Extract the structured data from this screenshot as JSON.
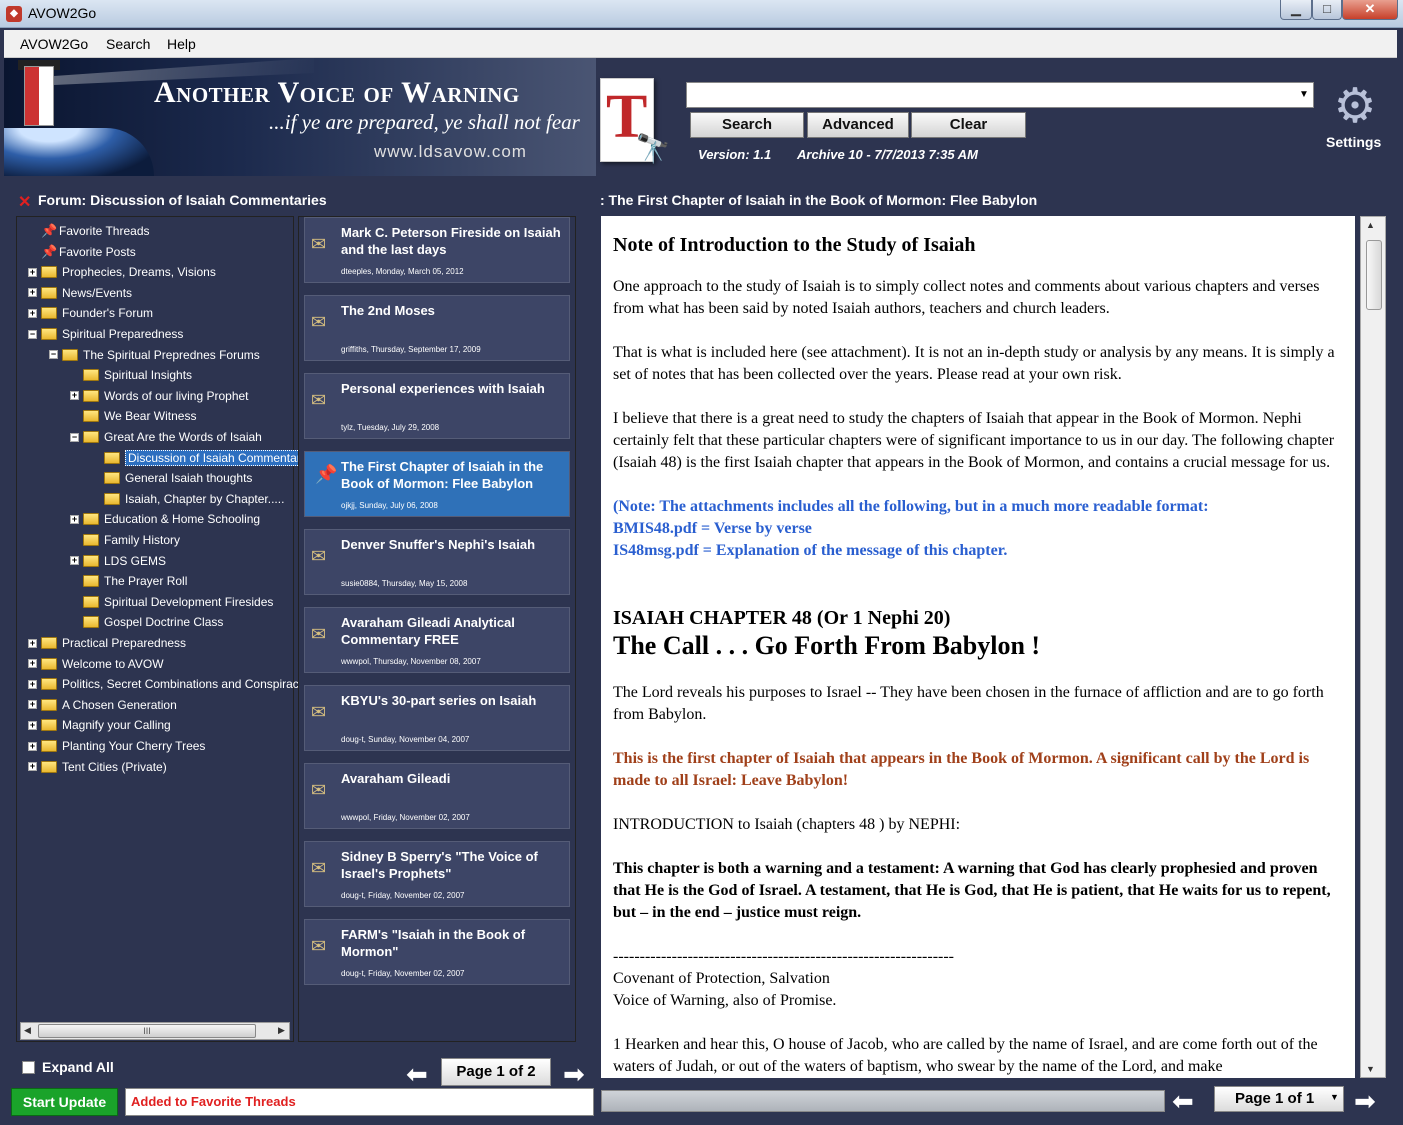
{
  "window": {
    "title": "AVOW2Go",
    "min": "▁",
    "max": "□",
    "close": "✕"
  },
  "menu": {
    "items": [
      "AVOW2Go",
      "Search",
      "Help"
    ]
  },
  "banner": {
    "title": "Another Voice of Warning",
    "subtitle": "...if ye are prepared, ye shall not fear",
    "url": "www.ldsavow.com"
  },
  "toolbar": {
    "search_value": "",
    "search_label": "Search",
    "advanced_label": "Advanced",
    "clear_label": "Clear",
    "version": "Version: 1.1",
    "archive": "Archive 10 - 7/7/2013 7:35 AM",
    "settings_label": "Settings"
  },
  "forum": {
    "title": "Forum: Discussion of Isaiah Commentaries"
  },
  "thread_header": {
    "title": ": The First Chapter of Isaiah in the Book of Mormon: Flee Babylon"
  },
  "tree": {
    "items": [
      {
        "label": "Favorite Threads",
        "type": "pin",
        "indent": 0
      },
      {
        "label": "Favorite Posts",
        "type": "pin",
        "indent": 0
      },
      {
        "label": "Prophecies, Dreams, Visions",
        "type": "folder",
        "exp": "+",
        "indent": 0
      },
      {
        "label": "News/Events",
        "type": "folder",
        "exp": "+",
        "indent": 0
      },
      {
        "label": "Founder's Forum",
        "type": "folder",
        "exp": "+",
        "indent": 0
      },
      {
        "label": "Spiritual Preparedness",
        "type": "folder",
        "exp": "−",
        "indent": 0
      },
      {
        "label": "The Spiritual Preprednes Forums",
        "type": "folder",
        "exp": "−",
        "indent": 1
      },
      {
        "label": "Spiritual Insights",
        "type": "folder",
        "indent": 2
      },
      {
        "label": "Words of our living Prophet",
        "type": "folder",
        "exp": "+",
        "indent": 2
      },
      {
        "label": "We Bear Witness",
        "type": "folder",
        "indent": 2
      },
      {
        "label": "Great Are the Words of Isaiah",
        "type": "folder",
        "exp": "−",
        "indent": 2
      },
      {
        "label": "Discussion of Isaiah Commentar",
        "type": "folder",
        "indent": 3,
        "selected": true
      },
      {
        "label": "General Isaiah thoughts",
        "type": "folder",
        "indent": 3
      },
      {
        "label": "Isaiah, Chapter by Chapter.....",
        "type": "folder",
        "indent": 3
      },
      {
        "label": "Education & Home Schooling",
        "type": "folder",
        "exp": "+",
        "indent": 2
      },
      {
        "label": "Family History",
        "type": "folder",
        "indent": 2
      },
      {
        "label": "LDS GEMS",
        "type": "folder",
        "exp": "+",
        "indent": 2
      },
      {
        "label": "The Prayer Roll",
        "type": "folder",
        "indent": 2
      },
      {
        "label": "Spiritual Development Firesides",
        "type": "folder",
        "indent": 2
      },
      {
        "label": "Gospel Doctrine Class",
        "type": "folder",
        "indent": 2
      },
      {
        "label": "Practical Preparedness",
        "type": "folder",
        "exp": "+",
        "indent": 0
      },
      {
        "label": "Welcome to AVOW",
        "type": "folder",
        "exp": "+",
        "indent": 0
      },
      {
        "label": "Politics, Secret Combinations and Conspiracie",
        "type": "folder",
        "exp": "+",
        "indent": 0
      },
      {
        "label": "A Chosen Generation",
        "type": "folder",
        "exp": "+",
        "indent": 0
      },
      {
        "label": "Magnify your Calling",
        "type": "folder",
        "exp": "+",
        "indent": 0
      },
      {
        "label": "Planting Your Cherry Trees",
        "type": "folder",
        "exp": "+",
        "indent": 0
      },
      {
        "label": "Tent Cities (Private)",
        "type": "folder",
        "exp": "+",
        "indent": 0
      }
    ],
    "hscroll_label": "III"
  },
  "threads": {
    "items": [
      {
        "title": "Mark C. Peterson Fireside on Isaiah and the last days",
        "meta": "dteeples,   Monday, March 05, 2012"
      },
      {
        "title": "The 2nd Moses",
        "meta": "griffiths,   Thursday, September 17, 2009"
      },
      {
        "title": "Personal experiences with Isaiah",
        "meta": "tylz,   Tuesday, July 29, 2008"
      },
      {
        "title": "The First Chapter of Isaiah in the Book of Mormon: Flee Babylon",
        "meta": "ojkjj,   Sunday, July 06, 2008",
        "selected": true
      },
      {
        "title": "Denver Snuffer's Nephi's Isaiah",
        "meta": "susie0884,   Thursday, May 15, 2008"
      },
      {
        "title": "Avaraham Gileadi Analytical Commentary FREE",
        "meta": "wwwpol,   Thursday, November 08, 2007"
      },
      {
        "title": "KBYU's 30-part series on Isaiah",
        "meta": "doug-t,   Sunday, November 04, 2007"
      },
      {
        "title": "Avaraham Gileadi",
        "meta": "wwwpol,   Friday, November 02, 2007"
      },
      {
        "title": "Sidney B Sperry's \"The Voice of Israel's Prophets\"",
        "meta": "doug-t,   Friday, November 02, 2007"
      },
      {
        "title": "FARM's \"Isaiah in the Book of Mormon\"",
        "meta": "doug-t,   Friday, November 02, 2007"
      }
    ],
    "page_label": "Page 1 of 2"
  },
  "content": {
    "heading": "Note of Introduction to the Study of Isaiah",
    "p1": "One approach to the study of Isaiah is to simply collect notes and comments about various chapters and verses from what has been said by noted Isaiah authors, teachers and church leaders.",
    "p2": "That is what is included here (see attachment). It is not an in-depth study or analysis by any means. It is simply a set of notes that has been collected over the years. Please read at your own risk.",
    "p3": "I believe that there is a great need to study the chapters of Isaiah that appear in the Book of Mormon. Nephi certainly felt that these particular chapters were of significant importance to us in our day. The following chapter (Isaiah 48) is the first Isaiah chapter that appears in the Book of Mormon, and contains a crucial message for us.",
    "note1": "(Note: The attachments includes all the following, but in a much more readable format:",
    "note2": "BMIS48.pdf = Verse by verse",
    "note3": "IS48msg.pdf = Explanation of the message of this chapter.",
    "chapter": "ISAIAH CHAPTER 48 (Or 1 Nephi 20)",
    "call": "The Call . . . Go Forth From Babylon !",
    "p4": "The Lord reveals his purposes to Israel -- They have been chosen in the furnace of affliction and are to go forth from Babylon.",
    "p5": "This is the first chapter of Isaiah that appears in the Book of Mormon. A significant call by the Lord is made to all Israel: Leave Babylon!",
    "p6": "INTRODUCTION to Isaiah (chapters 48 ) by NEPHI:",
    "p7": "This chapter is both a warning and a testament: A warning that God has clearly prophesied and proven that He is the God of Israel. A testament, that He is God, that He is patient, that He waits for us to repent, but – in the end – justice must reign.",
    "divider": "----------------------------------------------------------------",
    "p8a": "Covenant of Protection, Salvation",
    "p8b": "Voice of Warning, also of Promise.",
    "p9": "1 Hearken and hear this, O house of Jacob, who are called by the name of Israel, and are come forth out of the waters of Judah, or out of the waters of baptism, who swear by the name of the Lord, and make"
  },
  "footer": {
    "expand_all": "Expand All",
    "start_update": "Start Update",
    "status": "Added to Favorite Threads",
    "content_page": "Page 1 of 1"
  }
}
